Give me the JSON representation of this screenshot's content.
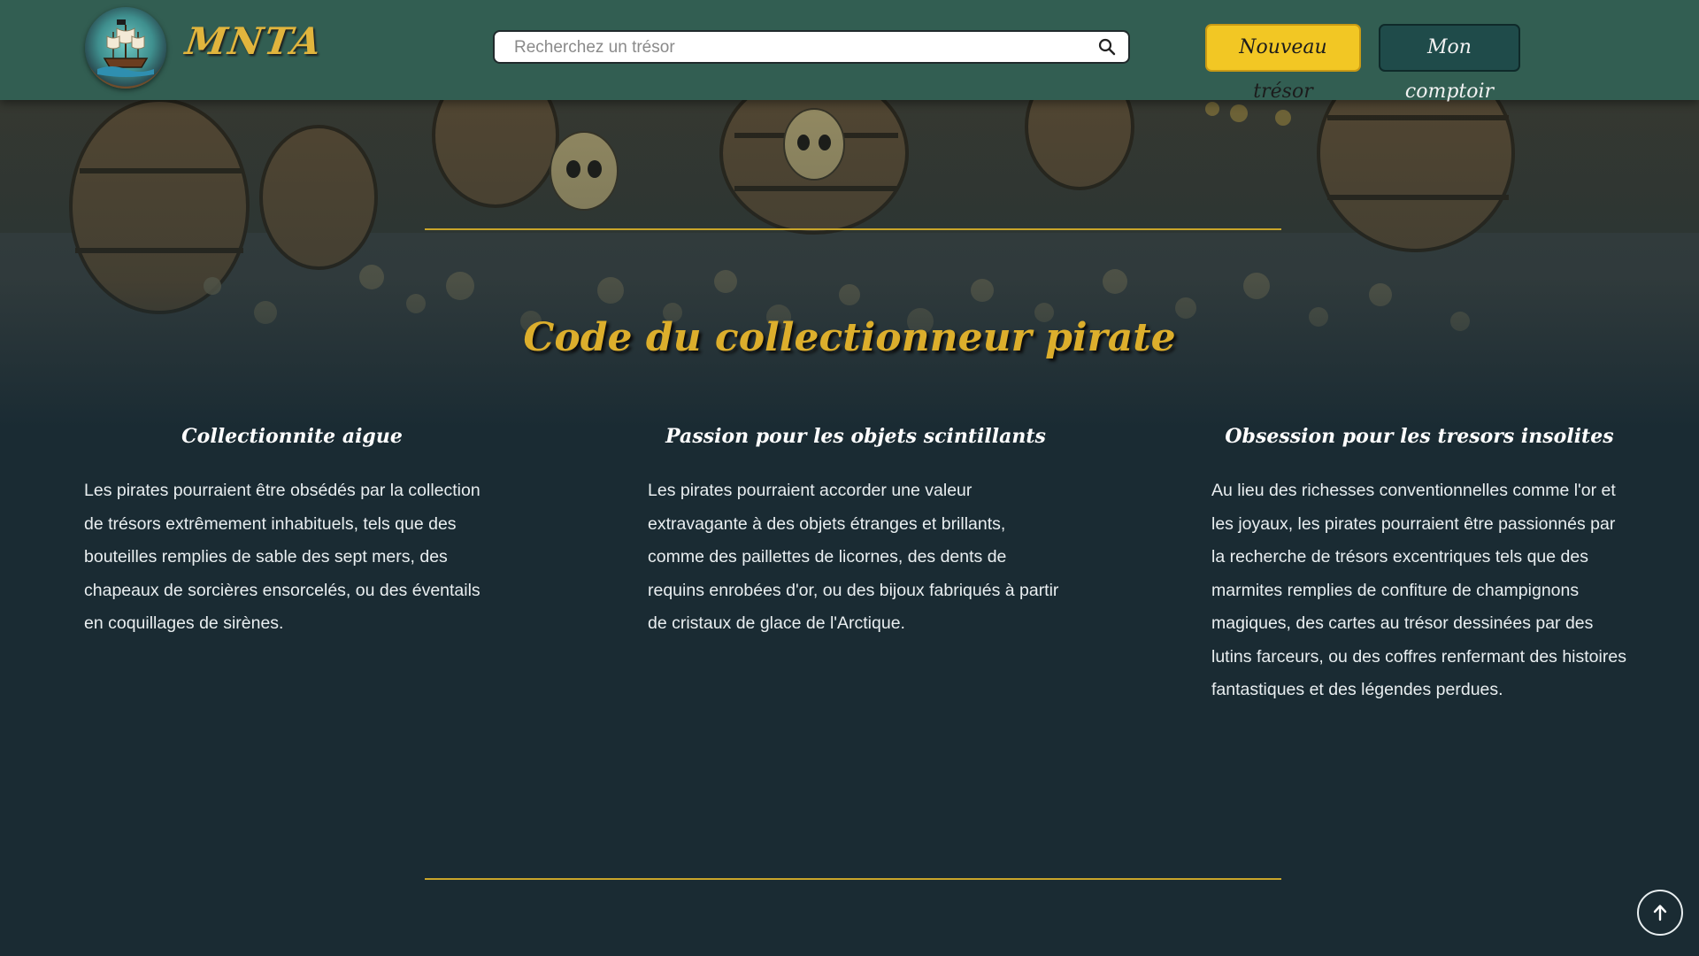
{
  "header": {
    "brand": "MNTA",
    "search_placeholder": "Recherchez un trésor",
    "new_treasure_label": "Nouveau trésor",
    "my_counter_label": "Mon comptoir"
  },
  "main": {
    "title": "Code du collectionneur pirate",
    "columns": [
      {
        "heading": "Collectionnite aigue",
        "text": "Les pirates pourraient être obsédés par la collection de trésors extrêmement inhabituels, tels que des bouteilles remplies de sable des sept mers, des chapeaux de sorcières ensorcelés, ou des éventails en coquillages de sirènes."
      },
      {
        "heading": "Passion pour les objets scintillants",
        "text": "Les pirates pourraient accorder une valeur extravagante à des objets étranges et brillants, comme des paillettes de licornes, des dents de requins enrobées d'or, ou des bijoux fabriqués à partir de cristaux de glace de l'Arctique."
      },
      {
        "heading": "Obsession pour les tresors insolites",
        "text": "Au lieu des richesses conventionnelles comme l'or et les joyaux, les pirates pourraient être passionnés par la recherche de trésors excentriques tels que des marmites remplies de confiture de champignons magiques, des cartes au trésor dessinées par des lutins farceurs, ou des coffres renfermant des histoires fantastiques et des légendes perdues."
      }
    ]
  },
  "icons": {
    "logo": "pirate-ship-logo-icon",
    "search": "search-icon",
    "back_to_top": "arrow-up-icon"
  },
  "colors": {
    "header_bg": "#325e52",
    "page_bg": "#1a2b33",
    "accent_gold": "#dcae2c",
    "button_yellow": "#f2c724",
    "button_dark": "#1f4b4a"
  }
}
